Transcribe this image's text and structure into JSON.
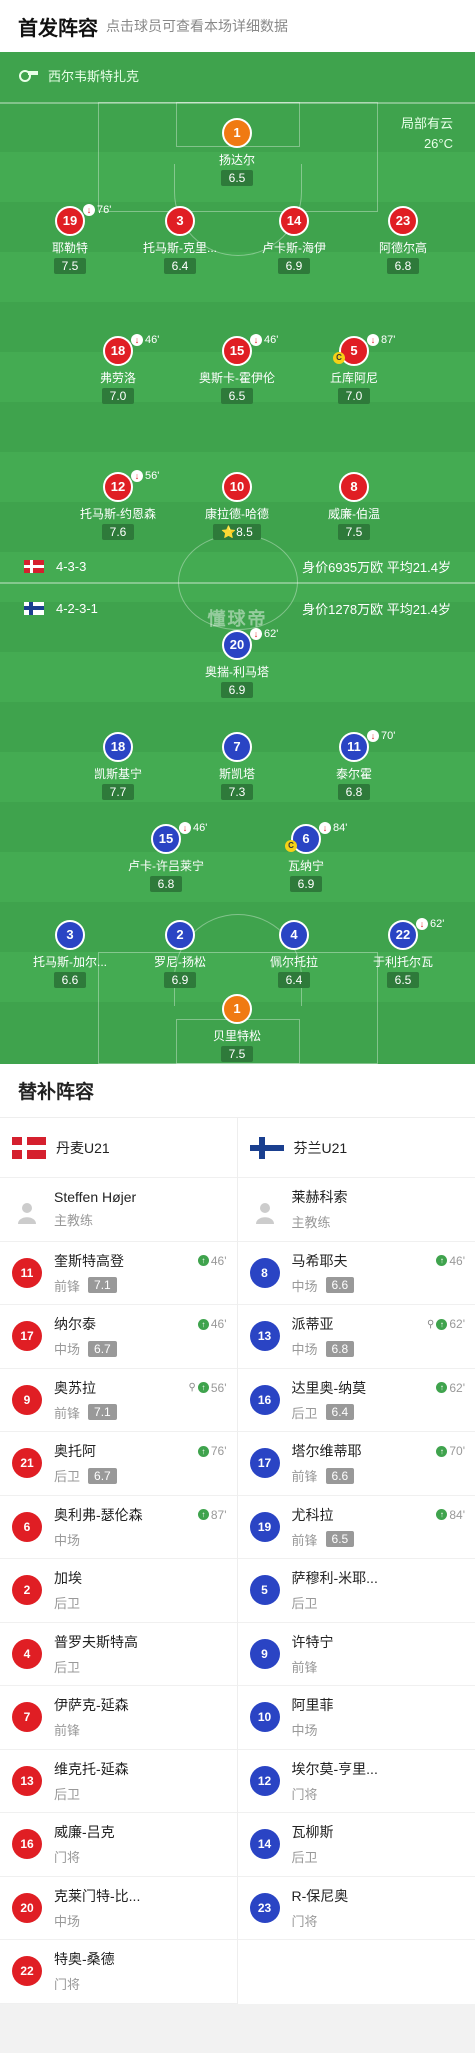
{
  "header": {
    "title": "首发阵容",
    "subtitle": "点击球员可查看本场详细数据"
  },
  "pitch": {
    "referee": "西尔韦斯特扎克",
    "weather": "局部有云",
    "temperature": "26°C",
    "watermark": "懂球帝",
    "home_formation": {
      "flag": "denmark-flag",
      "formation": "4-3-3",
      "value": "身价6935万欧 平均21.4岁"
    },
    "away_formation": {
      "flag": "finland-flag",
      "formation": "4-2-3-1",
      "value": "身价1278万欧 平均21.4岁"
    },
    "home_players": [
      {
        "num": "1",
        "name": "扬达尔",
        "rating": "6.5",
        "color": "orange"
      },
      {
        "num": "19",
        "name": "耶勒特",
        "rating": "7.5",
        "color": "red",
        "sub": "76'"
      },
      {
        "num": "3",
        "name": "托马斯-克里...",
        "rating": "6.4",
        "color": "red"
      },
      {
        "num": "14",
        "name": "卢卡斯-海伊",
        "rating": "6.9",
        "color": "red"
      },
      {
        "num": "23",
        "name": "阿德尔高",
        "rating": "6.8",
        "color": "red"
      },
      {
        "num": "18",
        "name": "弗劳洛",
        "rating": "7.0",
        "color": "red",
        "sub": "46'"
      },
      {
        "num": "15",
        "name": "奥斯卡-霍伊伦",
        "rating": "6.5",
        "color": "red",
        "sub": "46'"
      },
      {
        "num": "5",
        "name": "丘库阿尼",
        "rating": "7.0",
        "color": "red",
        "sub": "87'",
        "captain": "C"
      },
      {
        "num": "12",
        "name": "托马斯-约恩森",
        "rating": "7.6",
        "color": "red",
        "sub": "56'"
      },
      {
        "num": "10",
        "name": "康拉德-哈德",
        "rating": "8.5",
        "color": "red",
        "star": "⭐"
      },
      {
        "num": "8",
        "name": "威廉-伯温",
        "rating": "7.5",
        "color": "red"
      }
    ],
    "away_players": [
      {
        "num": "20",
        "name": "奥揣-利马塔",
        "rating": "6.9",
        "color": "blue",
        "sub": "62'"
      },
      {
        "num": "18",
        "name": "凯斯基宁",
        "rating": "7.7",
        "color": "blue"
      },
      {
        "num": "7",
        "name": "斯凯塔",
        "rating": "7.3",
        "color": "blue"
      },
      {
        "num": "11",
        "name": "泰尔霍",
        "rating": "6.8",
        "color": "blue",
        "sub": "70'"
      },
      {
        "num": "15",
        "name": "卢卡-许吕莱宁",
        "rating": "6.8",
        "color": "blue",
        "sub": "46'"
      },
      {
        "num": "6",
        "name": "瓦纳宁",
        "rating": "6.9",
        "color": "blue",
        "sub": "84'",
        "captain": "C"
      },
      {
        "num": "3",
        "name": "托马斯-加尔...",
        "rating": "6.6",
        "color": "blue"
      },
      {
        "num": "2",
        "name": "罗尼-扬松",
        "rating": "6.9",
        "color": "blue"
      },
      {
        "num": "4",
        "name": "佩尔托拉",
        "rating": "6.4",
        "color": "blue"
      },
      {
        "num": "22",
        "name": "于利托尔瓦",
        "rating": "6.5",
        "color": "blue",
        "sub": "62'"
      },
      {
        "num": "1",
        "name": "贝里特松",
        "rating": "7.5",
        "color": "orange"
      }
    ]
  },
  "subs": {
    "title": "替补阵容",
    "home": {
      "team": "丹麦U21",
      "coach": {
        "name": "Steffen Højer",
        "role": "主教练"
      },
      "players": [
        {
          "num": "11",
          "name": "奎斯特高登",
          "pos": "前锋",
          "rating": "7.1",
          "minute": "46'"
        },
        {
          "num": "17",
          "name": "纳尔泰",
          "pos": "中场",
          "rating": "6.7",
          "minute": "46'"
        },
        {
          "num": "9",
          "name": "奥苏拉",
          "pos": "前锋",
          "rating": "7.1",
          "minute": "56'",
          "assist": true
        },
        {
          "num": "21",
          "name": "奥托阿",
          "pos": "后卫",
          "rating": "6.7",
          "minute": "76'"
        },
        {
          "num": "6",
          "name": "奥利弗-瑟伦森",
          "pos": "中场",
          "rating": "",
          "minute": "87'"
        },
        {
          "num": "2",
          "name": "加埃",
          "pos": "后卫",
          "rating": "",
          "minute": ""
        },
        {
          "num": "4",
          "name": "普罗夫斯特高",
          "pos": "后卫",
          "rating": "",
          "minute": ""
        },
        {
          "num": "7",
          "name": "伊萨克-延森",
          "pos": "前锋",
          "rating": "",
          "minute": ""
        },
        {
          "num": "13",
          "name": "维克托-延森",
          "pos": "后卫",
          "rating": "",
          "minute": ""
        },
        {
          "num": "16",
          "name": "威廉-吕克",
          "pos": "门将",
          "rating": "",
          "minute": ""
        },
        {
          "num": "20",
          "name": "克莱门特-比...",
          "pos": "中场",
          "rating": "",
          "minute": ""
        },
        {
          "num": "22",
          "name": "特奥-桑德",
          "pos": "门将",
          "rating": "",
          "minute": ""
        }
      ]
    },
    "away": {
      "team": "芬兰U21",
      "coach": {
        "name": "莱赫科索",
        "role": "主教练"
      },
      "players": [
        {
          "num": "8",
          "name": "马希耶夫",
          "pos": "中场",
          "rating": "6.6",
          "minute": "46'"
        },
        {
          "num": "13",
          "name": "派蒂亚",
          "pos": "中场",
          "rating": "6.8",
          "minute": "62'",
          "assist": true
        },
        {
          "num": "16",
          "name": "达里奥-纳莫",
          "pos": "后卫",
          "rating": "6.4",
          "minute": "62'"
        },
        {
          "num": "17",
          "name": "塔尔维蒂耶",
          "pos": "前锋",
          "rating": "6.6",
          "minute": "70'"
        },
        {
          "num": "19",
          "name": "尤科拉",
          "pos": "前锋",
          "rating": "6.5",
          "minute": "84'"
        },
        {
          "num": "5",
          "name": "萨穆利-米耶...",
          "pos": "后卫",
          "rating": "",
          "minute": ""
        },
        {
          "num": "9",
          "name": "许特宁",
          "pos": "前锋",
          "rating": "",
          "minute": ""
        },
        {
          "num": "10",
          "name": "阿里菲",
          "pos": "中场",
          "rating": "",
          "minute": ""
        },
        {
          "num": "12",
          "name": "埃尔莫-亨里...",
          "pos": "门将",
          "rating": "",
          "minute": ""
        },
        {
          "num": "14",
          "name": "瓦柳斯",
          "pos": "后卫",
          "rating": "",
          "minute": ""
        },
        {
          "num": "23",
          "name": "R-保尼奥",
          "pos": "门将",
          "rating": "",
          "minute": ""
        }
      ]
    }
  }
}
